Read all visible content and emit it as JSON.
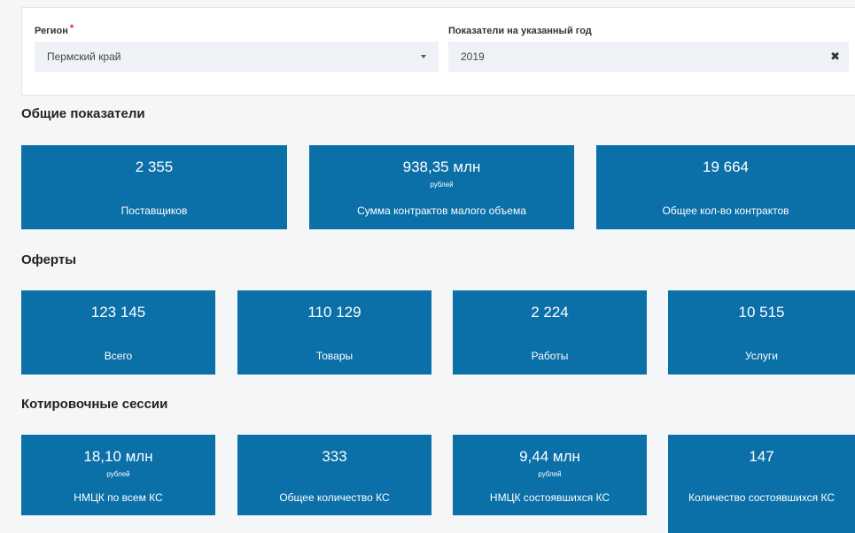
{
  "filters": {
    "region": {
      "label": "Регион",
      "required_mark": "*",
      "value": "Пермский край"
    },
    "year": {
      "label": "Показатели на указанный год",
      "value": "2019"
    }
  },
  "sections": {
    "general": {
      "title": "Общие показатели",
      "cards": [
        {
          "value": "2 355",
          "unit": "",
          "label": "Поставщиков"
        },
        {
          "value": "938,35 млн",
          "unit": "рублей",
          "label": "Сумма контрактов малого объема"
        },
        {
          "value": "19 664",
          "unit": "",
          "label": "Общее кол-во контрактов"
        }
      ]
    },
    "offers": {
      "title": "Оферты",
      "cards": [
        {
          "value": "123 145",
          "label": "Всего"
        },
        {
          "value": "110 129",
          "label": "Товары"
        },
        {
          "value": "2 224",
          "label": "Работы"
        },
        {
          "value": "10 515",
          "label": "Услуги"
        }
      ]
    },
    "sessions": {
      "title": "Котировочные сессии",
      "cards": [
        {
          "value": "18,10 млн",
          "unit": "рублей",
          "label": "НМЦК по всем КС"
        },
        {
          "value": "333",
          "unit": "",
          "label": "Общее количество КС"
        },
        {
          "value": "9,44 млн",
          "unit": "рублей",
          "label": "НМЦК состоявшихся КС"
        },
        {
          "value": "147",
          "unit": "",
          "label": "Количество состоявшихся КС"
        }
      ]
    }
  },
  "colors": {
    "card_bg": "#0b6fa8",
    "page_bg": "#f5f6f7",
    "select_bg": "#eef1f6",
    "required": "#e02020"
  }
}
